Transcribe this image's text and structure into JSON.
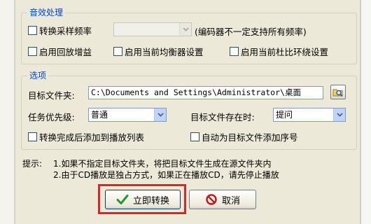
{
  "sound_processing": {
    "title": "音效处理",
    "convert_sample_rate_label": "转换采样频率",
    "sample_rate_value": "",
    "sample_rate_note": "(编码器不一定支持所有频率)",
    "enable_replay_gain_label": "启用回放增益",
    "enable_equalizer_label": "启用当前均衡器设置",
    "enable_dolby_label": "启用当前杜比环绕设置"
  },
  "options": {
    "title": "选项",
    "target_folder_label": "目标文件夹:",
    "target_folder_value": "C:\\Documents and Settings\\Administrator\\桌面",
    "priority_label": "任务优先级:",
    "priority_value": "普通",
    "file_exists_label": "目标文件存在时:",
    "file_exists_value": "提问",
    "add_to_playlist_label": "转换完成后添加到播放列表",
    "add_sequence_number_label": "自动为目标文件添加序号"
  },
  "hint": {
    "prefix": "提示:",
    "line1": "1.如果不指定目标文件夹，将把目标文件生成在源文件夹内",
    "line2": "2.由于CD播放是独占方式，如果正在播放CD，请先停止播放"
  },
  "buttons": {
    "convert_now_label": "立即转换",
    "cancel_label": "取消"
  },
  "colors": {
    "dialog_bg": "#ece9d8",
    "legend_text": "#0046d5",
    "highlight_box": "#d9262b",
    "ok_check": "#1f9a2c",
    "cancel_icon": "#c4161c"
  }
}
